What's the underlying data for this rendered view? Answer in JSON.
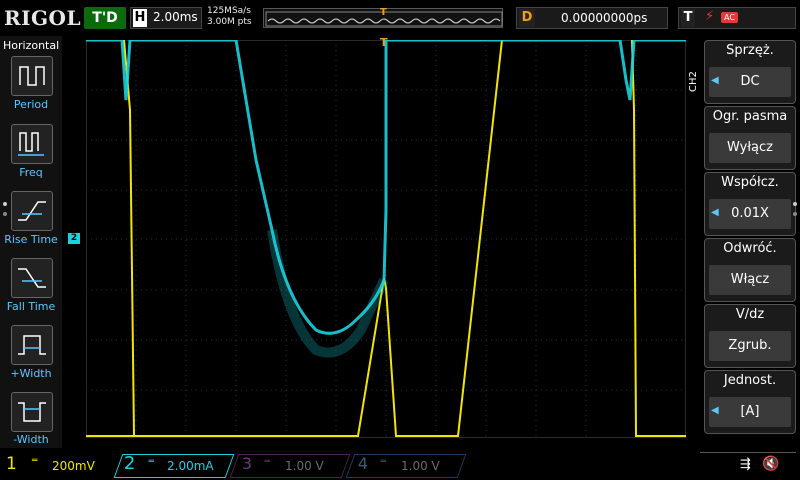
{
  "brand": "RIGOL",
  "run_state": "T'D",
  "horizontal": {
    "tag": "H",
    "timebase": "2.00ms",
    "sample_rate": "125MSa/s",
    "mem_depth": "3.00M pts"
  },
  "delay": {
    "tag": "D",
    "value": "0.00000000ps"
  },
  "trigger": {
    "tag": "T",
    "source": "AC",
    "marker": "T"
  },
  "left_menu": {
    "title": "Horizontal",
    "items": [
      {
        "label": "Period"
      },
      {
        "label": "Freq"
      },
      {
        "label": "Rise Time"
      },
      {
        "label": "Fall Time"
      },
      {
        "label": "+Width"
      },
      {
        "label": "-Width"
      }
    ]
  },
  "right_menu": {
    "channel": "CH2",
    "items": [
      {
        "header": "Sprzęż.",
        "value": "DC",
        "arrow": true
      },
      {
        "header": "Ogr. pasma",
        "value": "Wyłącz",
        "arrow": false
      },
      {
        "header": "Współcz.",
        "value": "0.01X",
        "arrow": true
      },
      {
        "header": "Odwróć.",
        "value": "Włącz",
        "arrow": false
      },
      {
        "header": "V/dz",
        "value": "Zgrub.",
        "arrow": false
      },
      {
        "header": "Jednost.",
        "value": "[A]",
        "arrow": true
      }
    ]
  },
  "channels": [
    {
      "num": "1",
      "scale": "200mV",
      "color": "#f2e600",
      "active": true
    },
    {
      "num": "2",
      "scale": "2.00mA",
      "color": "#19d3e0",
      "active": true
    },
    {
      "num": "3",
      "scale": "1.00 V",
      "color": "#c23bd0",
      "active": false
    },
    {
      "num": "4",
      "scale": "1.00 V",
      "color": "#2f7de1",
      "active": false
    }
  ],
  "ch2_marker": "2",
  "colors": {
    "ch1": "#f2e600",
    "ch2": "#19d3e0",
    "accent": "#5ac8ff",
    "trigger": "#f39c12"
  }
}
